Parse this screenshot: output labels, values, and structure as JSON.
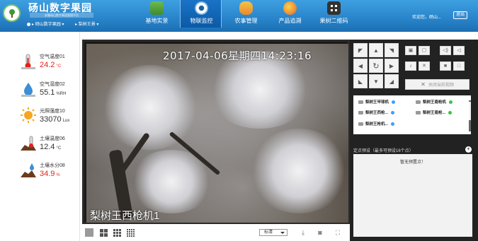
{
  "header": {
    "brand_title": "砀山数字果园",
    "brand_subtitle": "安徽砀山数字果园管理平台",
    "location_1": "砀山数字果园",
    "location_2": "梨树王景",
    "user_greeting": "欢迎您，砀山...",
    "logout_label": "退出",
    "tabs": [
      {
        "label": "基地实景",
        "icon": "field-icon",
        "color": "#4a9e3f"
      },
      {
        "label": "物联监控",
        "icon": "camera-icon",
        "color": "#ffffff"
      },
      {
        "label": "农事管理",
        "icon": "worker-icon",
        "color": "#f0a030"
      },
      {
        "label": "产品追溯",
        "icon": "fruit-basket-icon",
        "color": "#e85a2a"
      },
      {
        "label": "果树二维码",
        "icon": "qrcode-icon",
        "color": "#f5f5f5"
      }
    ]
  },
  "sensors": [
    {
      "name": "空气温度01",
      "value": "24.2",
      "unit": "°C",
      "icon": "thermometer-icon"
    },
    {
      "name": "空气湿度02",
      "value": "55.1",
      "unit": "%RH",
      "icon": "humidity-drop-icon"
    },
    {
      "name": "光照强度10",
      "value": "33070",
      "unit": "Lux",
      "icon": "sun-icon"
    },
    {
      "name": "土壤温度06",
      "value": "12.4",
      "unit": "°C",
      "icon": "soil-thermometer-icon"
    },
    {
      "name": "土壤水分08",
      "value": "34.9",
      "unit": "%",
      "icon": "soil-moisture-icon"
    }
  ],
  "video": {
    "timestamp": "2017-04-06星期四14:23:16",
    "caption": "梨树王西枪机1",
    "quality": "标清"
  },
  "panel": {
    "close_preview_label": "关闭当前视频",
    "cameras": [
      {
        "label": "梨树王甲球机",
        "status_color": "#3aa0ff"
      },
      {
        "label": "梨树王南枪机",
        "status_color": "#39c24a"
      },
      {
        "label": "梨树王西枪...",
        "status_color": "#3aa0ff"
      },
      {
        "label": "梨树王南枪...",
        "status_color": "#39c24a"
      },
      {
        "label": "梨树王枪机...",
        "status_color": "#3aa0ff"
      }
    ],
    "preset_header": "定点预设（最多可预设16个点）",
    "preset_empty": "暂无预置点！"
  }
}
